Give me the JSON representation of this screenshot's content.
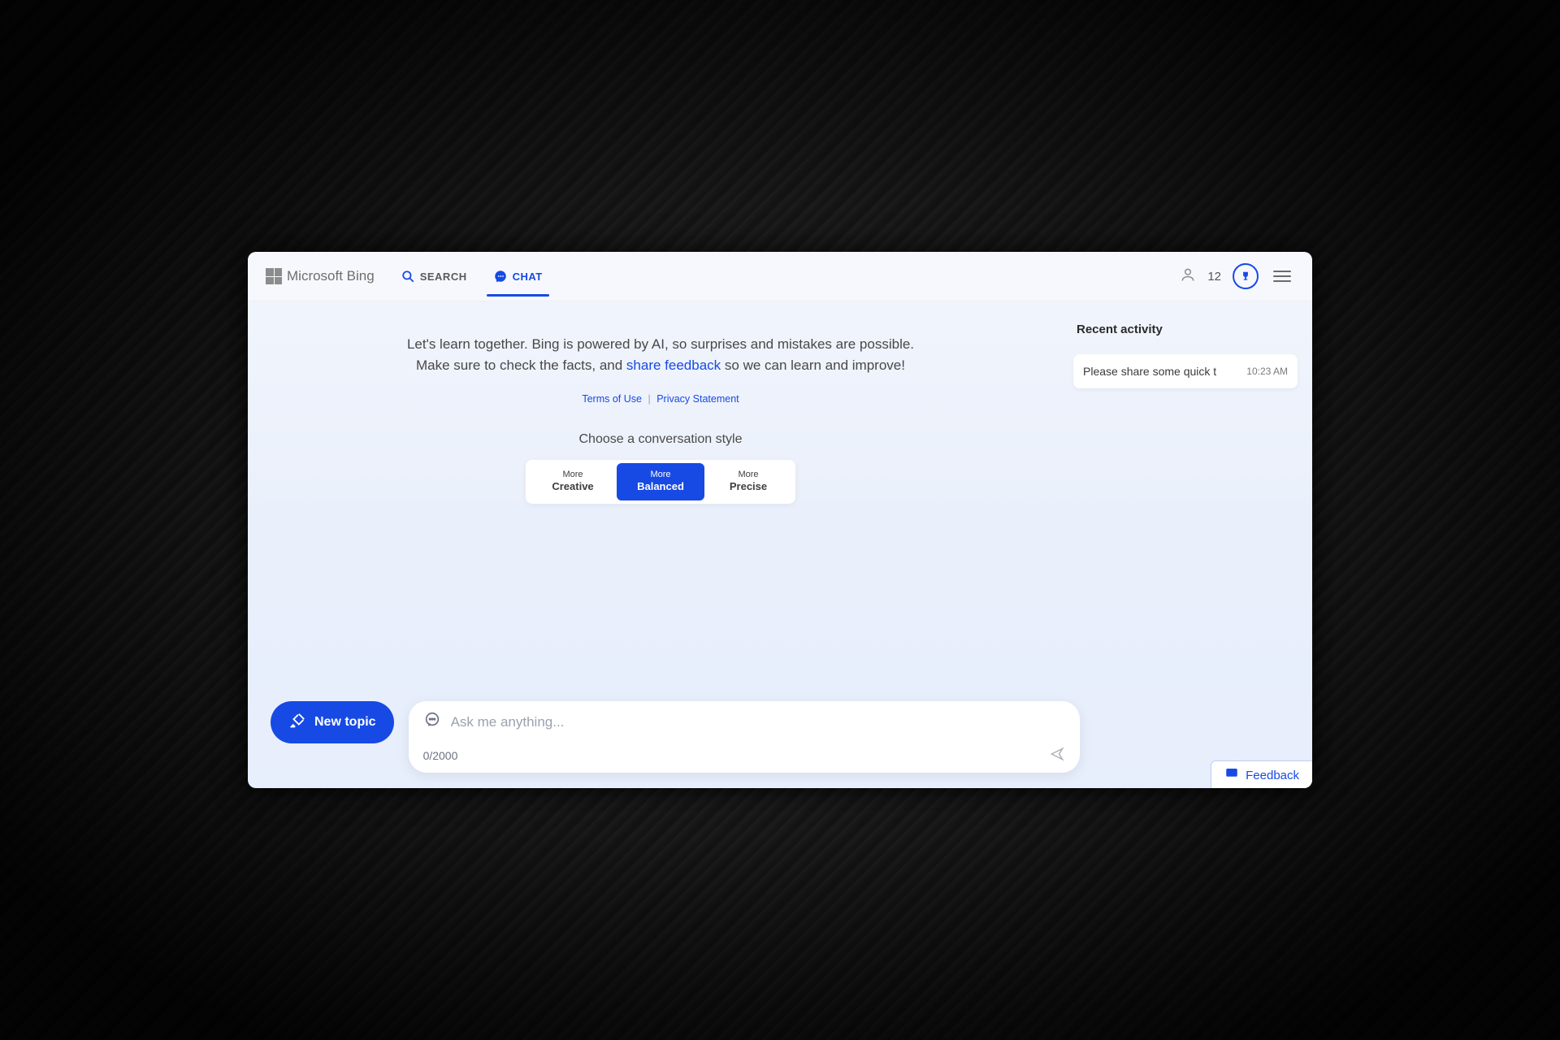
{
  "header": {
    "brand": "Microsoft Bing",
    "tabs": {
      "search": "SEARCH",
      "chat": "CHAT"
    },
    "points": "12"
  },
  "intro": {
    "line1_prefix": "Let's learn together. Bing is powered by AI, so surprises and mistakes are possible.",
    "line2_pre": "Make sure to check the facts, and ",
    "share_feedback": "share feedback",
    "line2_post": " so we can learn and improve!"
  },
  "legal": {
    "terms": "Terms of Use",
    "privacy": "Privacy Statement"
  },
  "style": {
    "heading": "Choose a conversation style",
    "more": "More",
    "creative": "Creative",
    "balanced": "Balanced",
    "precise": "Precise"
  },
  "bottom": {
    "new_topic": "New topic",
    "placeholder": "Ask me anything...",
    "counter": "0/2000"
  },
  "rail": {
    "heading": "Recent activity",
    "item_title": "Please share some quick t",
    "item_time": "10:23 AM"
  },
  "feedback": {
    "label": "Feedback"
  }
}
